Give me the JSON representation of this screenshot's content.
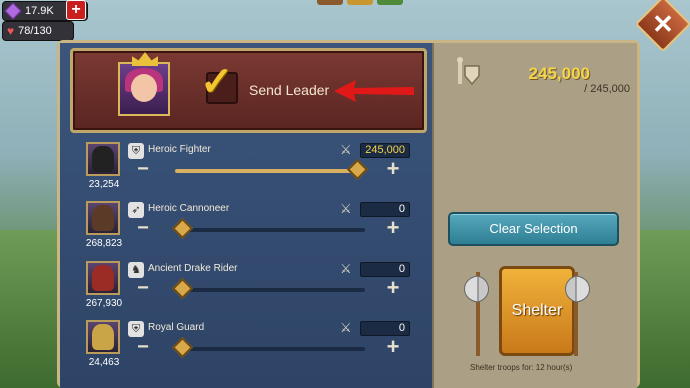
{
  "resources": {
    "gems": "17.9K",
    "stamina": "78/130"
  },
  "leader": {
    "label": "Send Leader",
    "checked": true
  },
  "troops": [
    {
      "name": "Heroic Fighter",
      "owned": "23,254",
      "selected": "245,000",
      "fill": 1.0,
      "type_icon": "shield-icon"
    },
    {
      "name": "Heroic Cannoneer",
      "owned": "268,823",
      "selected": "0",
      "fill": 0.0,
      "type_icon": "bow-icon"
    },
    {
      "name": "Ancient Drake Rider",
      "owned": "267,930",
      "selected": "0",
      "fill": 0.0,
      "type_icon": "horse-icon"
    },
    {
      "name": "Royal Guard",
      "owned": "24,463",
      "selected": "0",
      "fill": 0.0,
      "type_icon": "shield-icon"
    }
  ],
  "capacity": {
    "current": "245,000",
    "max": "/ 245,000"
  },
  "buttons": {
    "clear": "Clear Selection",
    "shelter": "Shelter"
  },
  "shelter_note": "Shelter troops for: 12 hour(s)",
  "colors": {
    "gold": "#f4d44a",
    "panel_blue": "#2e4466",
    "banner_red": "#7b3a33",
    "clear_teal": "#2e7e94",
    "shelter_orange": "#e8a22f"
  }
}
